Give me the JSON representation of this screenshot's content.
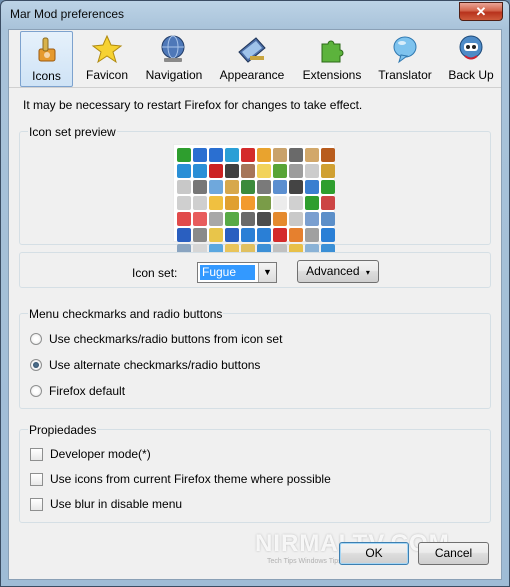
{
  "window": {
    "title": "Mar Mod preferences",
    "close_glyph": "✕"
  },
  "tabs": [
    {
      "label": "Icons",
      "icon": "icons-brush-icon",
      "active": true
    },
    {
      "label": "Favicon",
      "icon": "star-icon"
    },
    {
      "label": "Navigation",
      "icon": "navigation-globe-icon"
    },
    {
      "label": "Appearance",
      "icon": "appearance-monitor-icon"
    },
    {
      "label": "Extensions",
      "icon": "puzzle-piece-icon"
    },
    {
      "label": "Translator",
      "icon": "speech-bubble-icon"
    },
    {
      "label": "Back Up",
      "icon": "backup-robot-icon"
    }
  ],
  "notice": "It may be necessary to restart Firefox for changes to take effect.",
  "preview": {
    "title": "Icon set preview",
    "icon_colors": [
      "#2e9e2e",
      "#2a6fd1",
      "#2a6fd1",
      "#2a9fd6",
      "#d42b2b",
      "#e9a32e",
      "#c9a26b",
      "#6a6a6a",
      "#d2a86a",
      "#b85c1d",
      "#2a8fd6",
      "#2a8fd6",
      "#cc2222",
      "#404040",
      "#a6765a",
      "#f2d35a",
      "#58a436",
      "#9d9d9d",
      "#cccccc",
      "#d0a032",
      "#c8c8c8",
      "#777777",
      "#6fa8dc",
      "#d7a84c",
      "#3c8b3c",
      "#7a7a7a",
      "#5b8fd0",
      "#444444",
      "#3a7fd0",
      "#2e9e2e",
      "#cfcfcf",
      "#cfcfcf",
      "#f0c040",
      "#e0a030",
      "#f29a2e",
      "#7a9c48",
      "#ececec",
      "#d0d0d0",
      "#2e9e2e",
      "#cc4444",
      "#e14b4b",
      "#e85c5c",
      "#a8a8a8",
      "#58aa46",
      "#6a6a6a",
      "#4c4c4c",
      "#e58a2e",
      "#c9c9c9",
      "#7a9fd0",
      "#5c8fc9",
      "#2a5fc0",
      "#8a8a8a",
      "#e8c54a",
      "#2a5fc0",
      "#2a7fd6",
      "#2a7fd6",
      "#d42b2b",
      "#e6802e",
      "#a0a0a0",
      "#2a7fd6",
      "#8aa4c0",
      "#d6d6d6",
      "#5aa7e0",
      "#e9c45a",
      "#e0c060",
      "#3c8fd6",
      "#c0c0c0",
      "#e8c048",
      "#8ab2d6",
      "#3a8fd6"
    ]
  },
  "iconset": {
    "label": "Icon set:",
    "selected": "Fugue",
    "advanced_label": "Advanced"
  },
  "checkmarks": {
    "title": "Menu checkmarks and radio buttons",
    "options": [
      {
        "label": "Use checkmarks/radio buttons from icon set",
        "checked": false
      },
      {
        "label": "Use alternate checkmarks/radio buttons",
        "checked": true
      },
      {
        "label": "Firefox default",
        "checked": false
      }
    ]
  },
  "propiedades": {
    "title": "Propiedades",
    "options": [
      {
        "label": "Developer mode(*)",
        "checked": false
      },
      {
        "label": "Use icons from current Firefox theme where possible",
        "checked": false
      },
      {
        "label": "Use blur in disable menu",
        "checked": false
      }
    ]
  },
  "footer": {
    "ok": "OK",
    "cancel": "Cancel"
  },
  "watermark": {
    "main": "NIRMALTV.COM",
    "sub": "Tech Tips Windows Tips Tweaks"
  }
}
